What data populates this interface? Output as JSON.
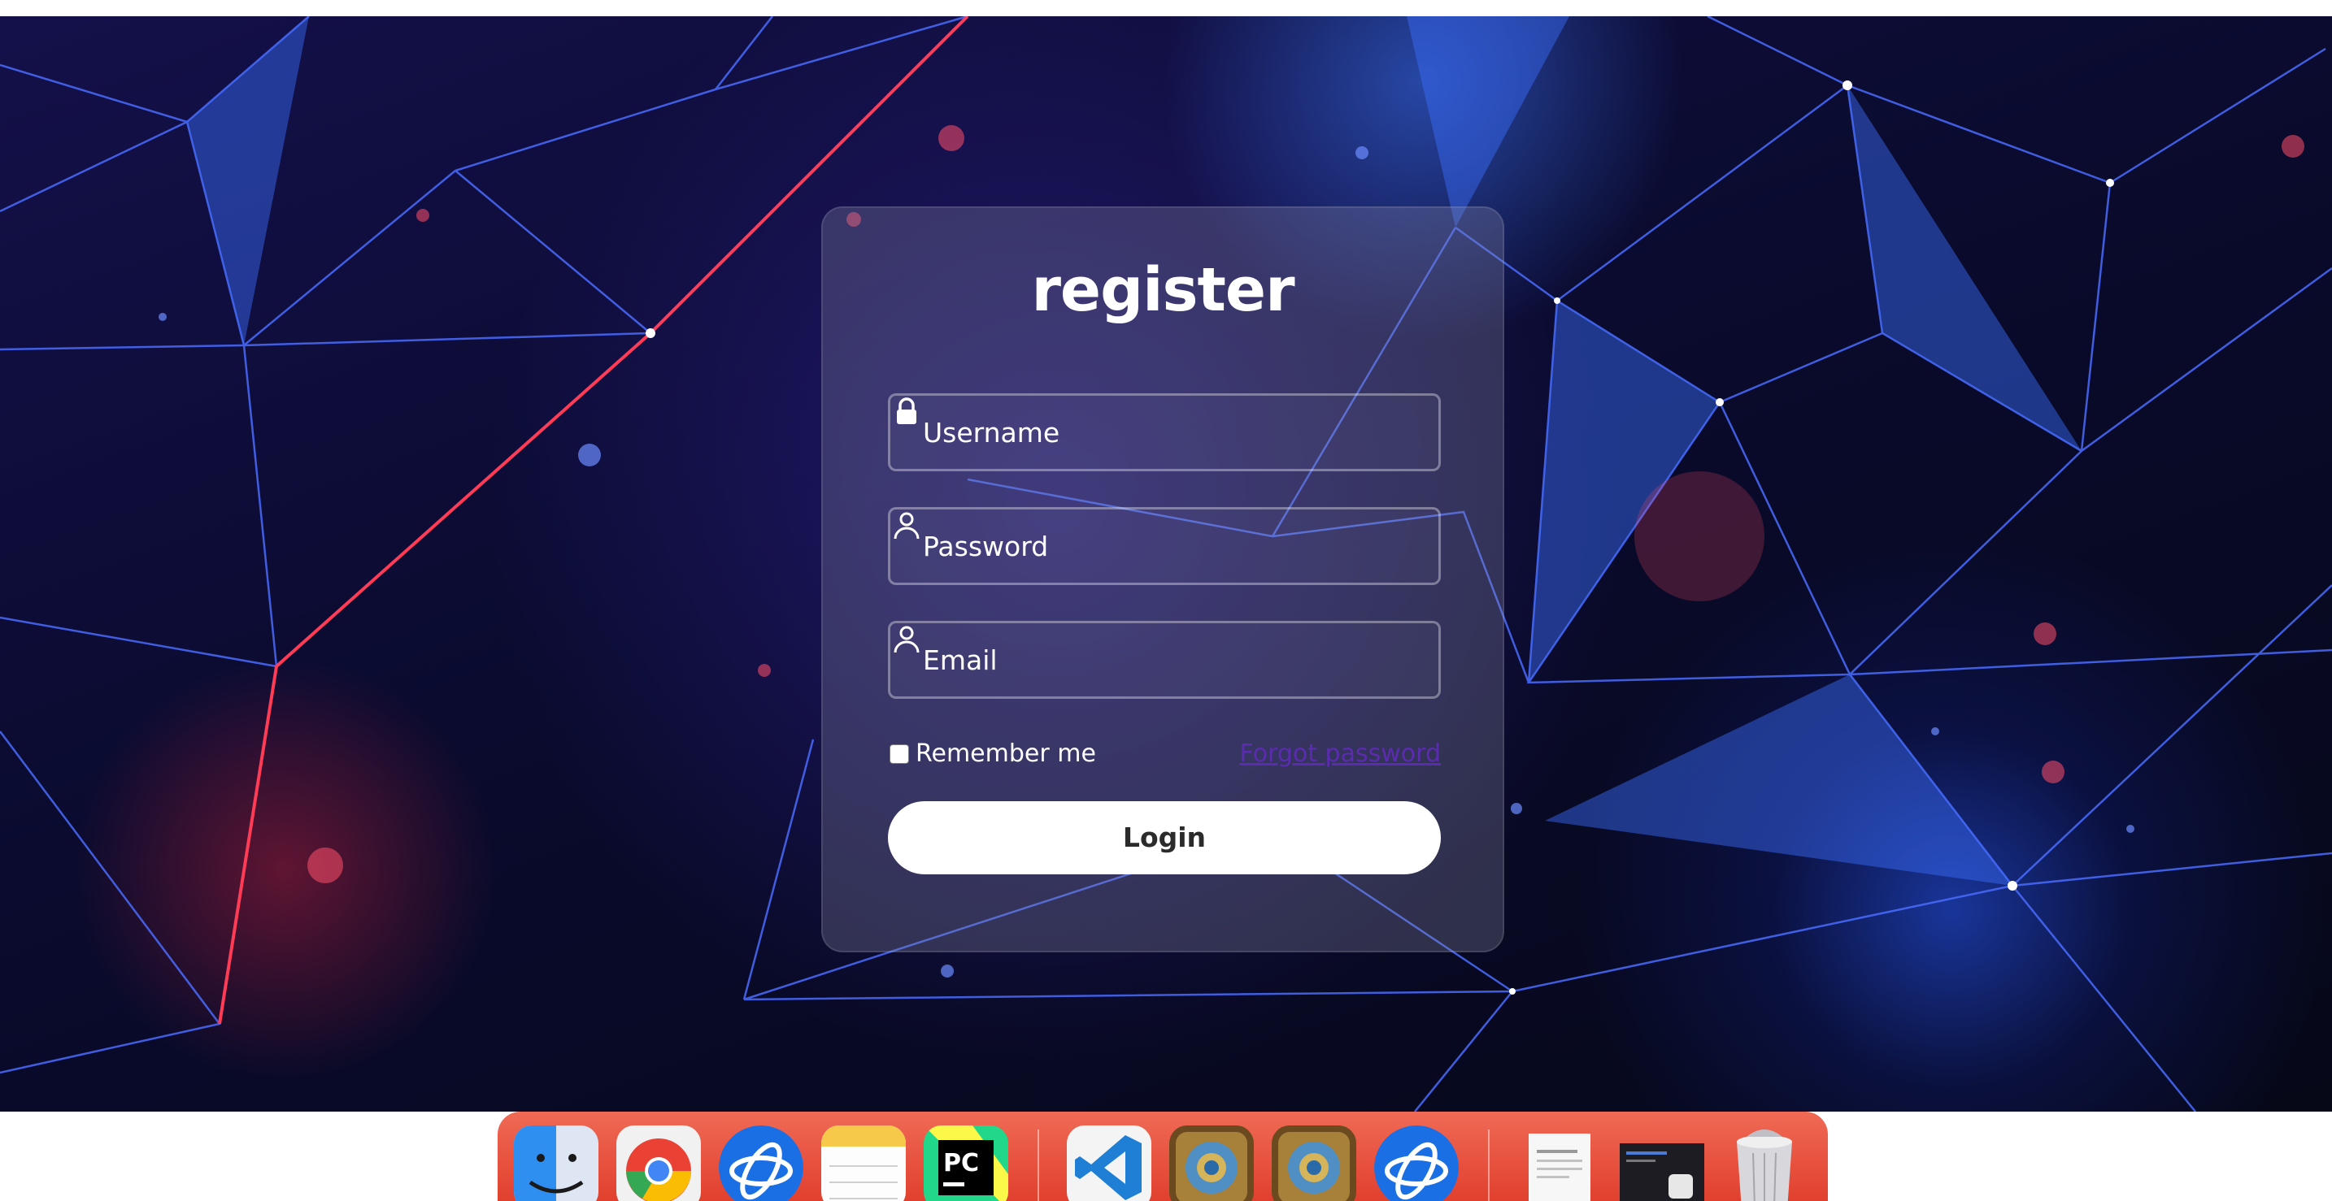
{
  "form": {
    "title": "register",
    "username_placeholder": "Username",
    "password_placeholder": "Password",
    "email_placeholder": "Email",
    "remember_label": "Remember me",
    "forgot_label": "Forgot password",
    "login_label": "Login"
  },
  "icons": {
    "username": "lock-icon",
    "password": "user-icon",
    "email": "user-icon"
  },
  "dock": {
    "apps": [
      "Finder",
      "Google Chrome",
      "Battle.net",
      "Notes",
      "PyCharm",
      "Visual Studio Code",
      "Hearthstone",
      "Hearthstone",
      "Battle.net",
      "Document",
      "Screenshot",
      "Trash"
    ]
  },
  "colors": {
    "accent_link": "#5b2bb0",
    "card_bg": "rgba(140,140,170,0.30)",
    "dock_bg": "#e1402e"
  }
}
